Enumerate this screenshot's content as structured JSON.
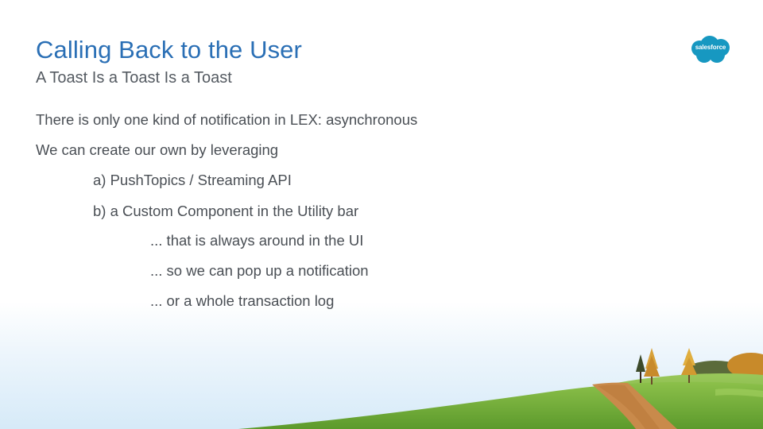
{
  "slide": {
    "title": "Calling Back to the User",
    "subtitle": "A Toast Is a Toast Is a Toast",
    "bullets": [
      "There is only one kind of notification in LEX: asynchronous",
      "We can create our own by leveraging",
      "a) PushTopics / Streaming API",
      "b) a Custom Component in the Utility bar",
      "... that is always around in the UI",
      "... so we can pop up a notification",
      "... or a whole transaction log"
    ]
  },
  "logo": {
    "text": "salesforce",
    "color": "#1798c1"
  },
  "colors": {
    "title": "#2a6fb5",
    "body_text": "#4a4f55",
    "grass": "#7fb53a",
    "path": "#c98a4b"
  },
  "icons": {
    "logo": "salesforce-cloud-logo",
    "landscape": "hill-with-trees-illustration"
  }
}
